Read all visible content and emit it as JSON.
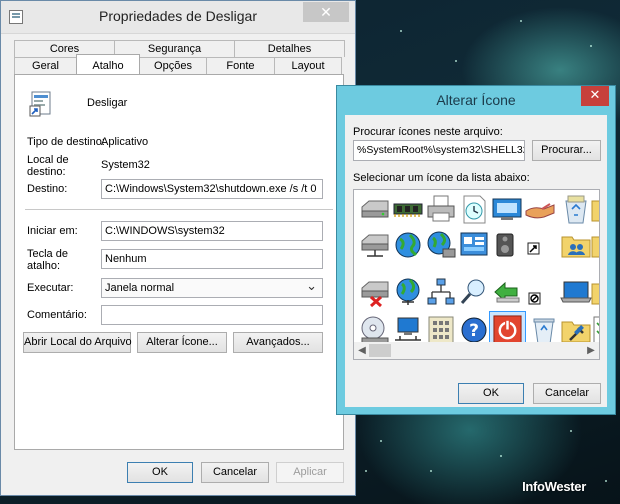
{
  "properties_window": {
    "title": "Propriedades de Desligar",
    "close_glyph": "✕",
    "tabs_back": [
      "Cores",
      "Segurança",
      "Detalhes"
    ],
    "tabs_front": [
      "Geral",
      "Atalho",
      "Opções",
      "Fonte",
      "Layout"
    ],
    "active_tab": "Atalho",
    "shortcut_name": "Desligar",
    "target_type_label": "Tipo de destino:",
    "target_type_value": "Aplicativo",
    "target_location_label": "Local de destino:",
    "target_location_value": "System32",
    "target_label": "Destino:",
    "target_value": "C:\\Windows\\System32\\shutdown.exe /s /t 0",
    "start_in_label": "Iniciar em:",
    "start_in_value": "C:\\WINDOWS\\system32",
    "shortcut_key_label": "Tecla de atalho:",
    "shortcut_key_value": "Nenhum",
    "run_label": "Executar:",
    "run_value": "Janela normal",
    "comment_label": "Comentário:",
    "comment_value": "",
    "open_location_button": "Abrir Local do Arquivo",
    "change_icon_button": "Alterar Ícone...",
    "advanced_button": "Avançados...",
    "ok_button": "OK",
    "cancel_button": "Cancelar",
    "apply_button": "Aplicar"
  },
  "change_icon_dialog": {
    "title": "Alterar Ícone",
    "close_glyph": "✕",
    "look_label": "Procurar ícones neste arquivo:",
    "file_value": "%SystemRoot%\\system32\\SHELL32.dll",
    "browse_button": "Procurar...",
    "select_label": "Selecionar um ícone da lista abaixo:",
    "ok_button": "OK",
    "cancel_button": "Cancelar",
    "selected_icon": "power-icon",
    "icons": [
      [
        "drive-icon",
        "memory-chip-icon",
        "printer-icon",
        "clock-document-icon",
        "monitor-window-icon",
        "hand-share-icon",
        "recycle-bin-full-icon"
      ],
      [
        "network-drive-icon",
        "globe-icon",
        "network-globe-icon",
        "control-panel-icon",
        "speaker-icon",
        "folder-people-icon"
      ],
      [
        "disconnected-drive-icon",
        "network-globe-2-icon",
        "network-nodes-icon",
        "search-icon",
        "back-arrow-icon",
        "laptop-icon"
      ],
      [
        "cd-drive-icon",
        "computer-network-icon",
        "keypad-icon",
        "help-icon",
        "power-icon",
        "recycle-bin-empty-icon",
        "folder-tools-icon"
      ]
    ]
  },
  "desktop": {
    "watermark": "InfoWester"
  },
  "colors": {
    "dialog_frame": "#6dcbe0",
    "close_red": "#c7403b",
    "selection_blue": "#3399ff"
  }
}
